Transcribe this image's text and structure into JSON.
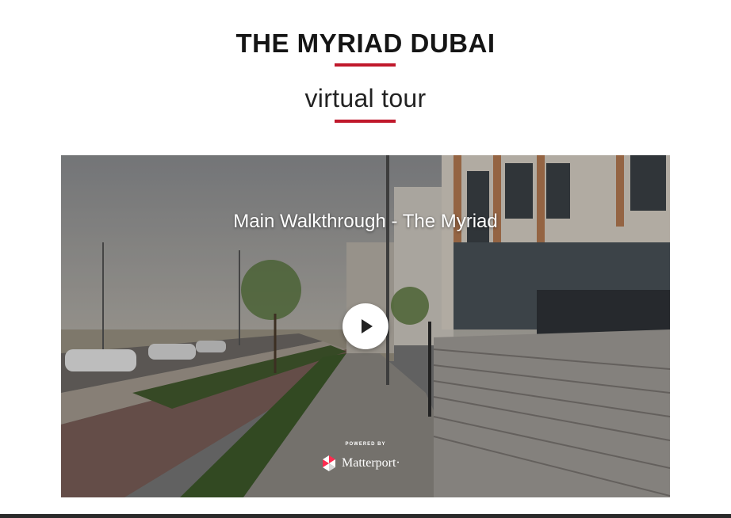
{
  "header": {
    "title": "THE MYRIAD DUBAI",
    "subtitle": "virtual tour"
  },
  "tour": {
    "title": "Main Walkthrough - The Myriad",
    "powered_by": "POWERED BY",
    "brand": "Matterport·"
  },
  "colors": {
    "accent": "#c0182b",
    "title_text": "#151515"
  }
}
